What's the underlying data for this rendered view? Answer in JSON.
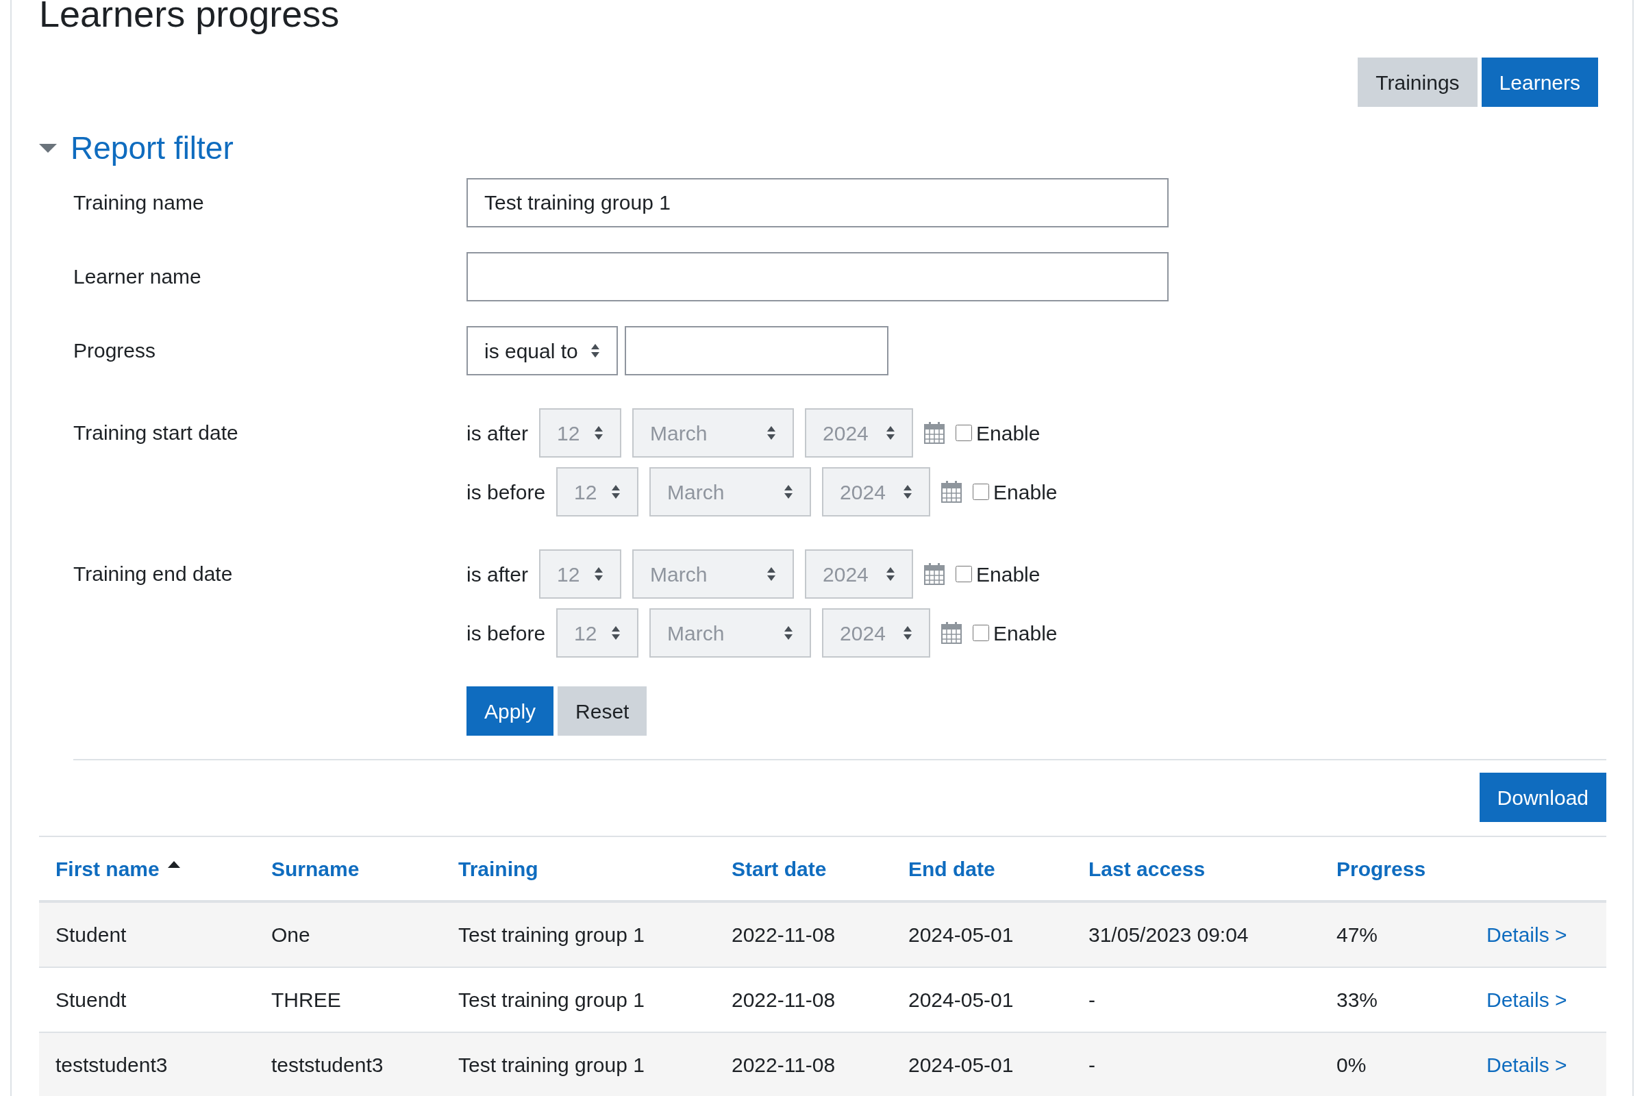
{
  "title": "Learners progress",
  "view_tabs": [
    {
      "label": "Trainings",
      "selected": false
    },
    {
      "label": "Learners",
      "selected": true
    }
  ],
  "filter": {
    "heading": "Report filter",
    "expanded": true,
    "text_fields": [
      {
        "label": "Training name",
        "value": "Test training group 1"
      },
      {
        "label": "Learner name"
      }
    ],
    "progress": {
      "label": "Progress",
      "operator": "is equal to"
    },
    "date_filters": [
      {
        "label": "Training start date",
        "conditions": [
          {
            "label": "is after",
            "day": "12",
            "month": "March",
            "year": "2024",
            "enable_label": "Enable",
            "enabled": false
          },
          {
            "label": "is before",
            "day": "12",
            "month": "March",
            "year": "2024",
            "enable_label": "Enable",
            "enabled": false
          }
        ]
      },
      {
        "label": "Training end date",
        "conditions": [
          {
            "label": "is after",
            "day": "12",
            "month": "March",
            "year": "2024",
            "enable_label": "Enable",
            "enabled": false
          },
          {
            "label": "is before",
            "day": "12",
            "month": "March",
            "year": "2024",
            "enable_label": "Enable",
            "enabled": false
          }
        ]
      }
    ],
    "buttons": [
      {
        "label": "Apply",
        "kind": "primary"
      },
      {
        "label": "Reset",
        "kind": "secondary"
      }
    ]
  },
  "download_button": "Download",
  "table": {
    "columns": [
      {
        "label": "First name",
        "sorted_ascending": true
      },
      {
        "label": "Surname",
        "sorted_ascending": false
      },
      {
        "label": "Training",
        "sorted_ascending": false
      },
      {
        "label": "Start date",
        "sorted_ascending": false
      },
      {
        "label": "End date",
        "sorted_ascending": false
      },
      {
        "label": "Last access",
        "sorted_ascending": false
      },
      {
        "label": "Progress",
        "sorted_ascending": false
      },
      {
        "sorted_ascending": false
      }
    ],
    "rows": [
      {
        "cells": [
          "Student",
          "One",
          "Test training group 1",
          "2022-11-08",
          "2024-05-01",
          "31/05/2023 09:04",
          "47%"
        ],
        "link": "Details >"
      },
      {
        "cells": [
          "Stuendt",
          "THREE",
          "Test training group 1",
          "2022-11-08",
          "2024-05-01",
          "-",
          "33%"
        ],
        "link": "Details >"
      },
      {
        "cells": [
          "teststudent3",
          "teststudent3",
          "Test training group 1",
          "2022-11-08",
          "2024-05-01",
          "-",
          "0%"
        ],
        "link": "Details >"
      }
    ]
  }
}
